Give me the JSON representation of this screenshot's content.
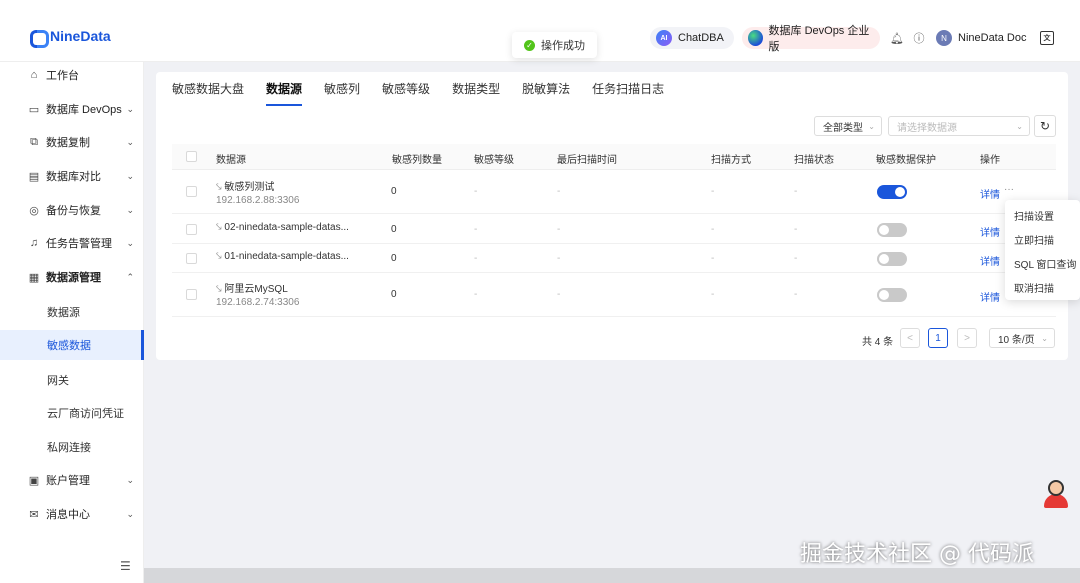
{
  "header": {
    "logo_text": "NineData",
    "toast": "操作成功",
    "chatdba": "ChatDBA",
    "ai_badge": "AI",
    "devops_edition": "数据库 DevOps 企业版",
    "user_name": "NineData Doc",
    "avatar_letter": "N"
  },
  "sidebar": {
    "items": [
      {
        "label": "工作台",
        "icon": "home-icon",
        "glyph": "⌂"
      },
      {
        "label": "数据库 DevOps",
        "icon": "monitor-icon",
        "glyph": "▭",
        "chev": "⌄"
      },
      {
        "label": "数据复制",
        "icon": "copy-icon",
        "glyph": "⧉",
        "chev": "⌄"
      },
      {
        "label": "数据库对比",
        "icon": "compare-icon",
        "glyph": "▤",
        "chev": "⌄"
      },
      {
        "label": "备份与恢复",
        "icon": "backup-icon",
        "glyph": "◎",
        "chev": "⌄"
      },
      {
        "label": "任务告警管理",
        "icon": "bell-icon",
        "glyph": "♫",
        "chev": "⌄"
      },
      {
        "label": "数据源管理",
        "icon": "datasource-icon",
        "glyph": "▦",
        "chev": "⌃"
      },
      {
        "label": "账户管理",
        "icon": "account-icon",
        "glyph": "▣",
        "chev": "⌄"
      },
      {
        "label": "消息中心",
        "icon": "mail-icon",
        "glyph": "✉",
        "chev": "⌄"
      }
    ],
    "sub_items": [
      "数据源",
      "敏感数据",
      "网关",
      "云厂商访问凭证",
      "私网连接"
    ]
  },
  "tabs": [
    "敏感数据大盘",
    "数据源",
    "敏感列",
    "敏感等级",
    "数据类型",
    "脱敏算法",
    "任务扫描日志"
  ],
  "filters": {
    "type_value": "全部类型",
    "source_placeholder": "请选择数据源"
  },
  "table": {
    "columns": [
      "数据源",
      "敏感列数量",
      "敏感等级",
      "最后扫描时间",
      "扫描方式",
      "扫描状态",
      "敏感数据保护",
      "操作"
    ],
    "rows": [
      {
        "name": "敏感列测试",
        "ip": "192.168.2.88:3306",
        "count": "0",
        "level": "-",
        "last_scan": "-",
        "method": "-",
        "status": "-",
        "protect": true,
        "action": "详情",
        "more": "···"
      },
      {
        "name": "02-ninedata-sample-datas...",
        "ip": "",
        "count": "0",
        "level": "-",
        "last_scan": "-",
        "method": "-",
        "status": "-",
        "protect": false,
        "action": "详情"
      },
      {
        "name": "01-ninedata-sample-datas...",
        "ip": "",
        "count": "0",
        "level": "-",
        "last_scan": "-",
        "method": "-",
        "status": "-",
        "protect": false,
        "action": "详情"
      },
      {
        "name": "阿里云MySQL",
        "ip": "192.168.2.74:3306",
        "count": "0",
        "level": "-",
        "last_scan": "-",
        "method": "-",
        "status": "-",
        "protect": false,
        "action": "详情"
      }
    ]
  },
  "pagination": {
    "total": "共 4 条",
    "current": "1",
    "prev": "<",
    "next": ">",
    "page_size": "10 条/页"
  },
  "dropdown": [
    "扫描设置",
    "立即扫描",
    "SQL 窗口查询",
    "取消扫描"
  ],
  "watermark": "掘金技术社区 @ 代码派",
  "colors": {
    "accent": "#1a56db",
    "success": "#52c41a"
  }
}
